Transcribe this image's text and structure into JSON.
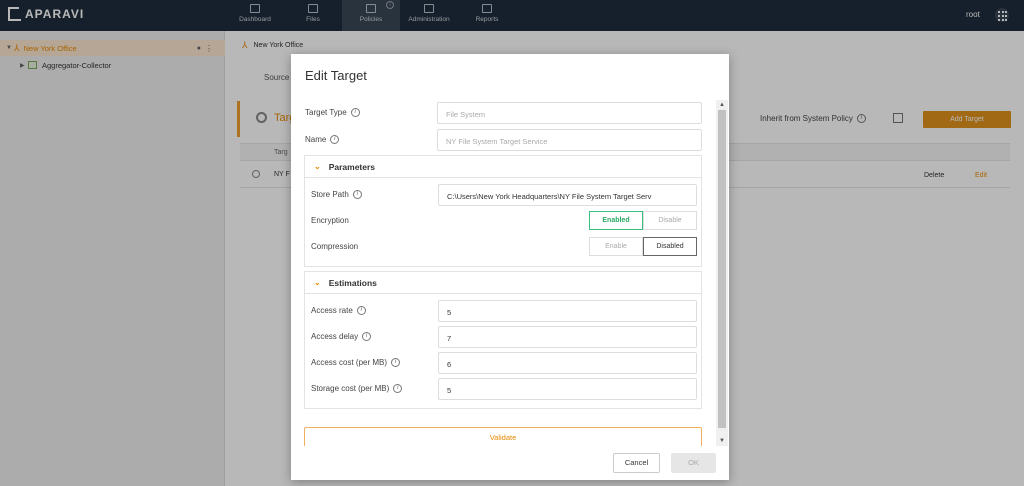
{
  "app": {
    "logo": "APARAVI",
    "user": "root"
  },
  "nav": [
    {
      "label": "Dashboard",
      "icon": "dashboard-icon"
    },
    {
      "label": "Files",
      "icon": "folder-icon"
    },
    {
      "label": "Policies",
      "icon": "policies-icon"
    },
    {
      "label": "Administration",
      "icon": "users-icon"
    },
    {
      "label": "Reports",
      "icon": "report-icon"
    }
  ],
  "sidebar": {
    "items": [
      {
        "label": "New York Office"
      },
      {
        "label": "Aggregator-Collector"
      }
    ]
  },
  "main": {
    "breadcrumb": "New York Office",
    "tab": "Source",
    "card_title": "Targ",
    "inherit_label": "Inherit from System Policy",
    "add_target": "Add Target",
    "table_header": "Targ",
    "row_name": "NY F",
    "row_delete": "Delete",
    "row_edit": "Edit"
  },
  "modal": {
    "title": "Edit Target",
    "target_type_label": "Target Type",
    "target_type_value": "File System",
    "name_label": "Name",
    "name_value": "NY File System Target Service",
    "parameters": {
      "title": "Parameters",
      "store_path_label": "Store Path",
      "store_path_value": "C:\\Users\\New York Headquarters\\NY File System Target Serv",
      "encryption_label": "Encryption",
      "encryption_on": "Enabled",
      "encryption_off": "Disable",
      "compression_label": "Compression",
      "compression_on": "Enable",
      "compression_off": "Disabled"
    },
    "estimations": {
      "title": "Estimations",
      "access_rate_label": "Access rate",
      "access_rate_value": "5",
      "access_delay_label": "Access delay",
      "access_delay_value": "7",
      "access_cost_label": "Access cost (per MB)",
      "access_cost_value": "6",
      "storage_cost_label": "Storage cost (per MB)",
      "storage_cost_value": "5"
    },
    "validate": "Validate",
    "cancel": "Cancel",
    "ok": "OK"
  }
}
